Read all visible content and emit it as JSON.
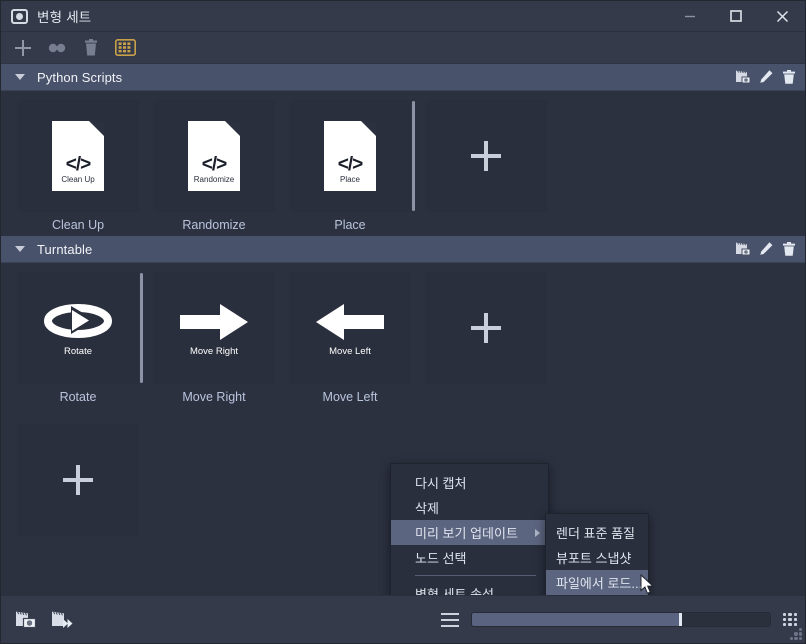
{
  "window": {
    "title": "변형 세트",
    "app_icon": "camera-icon",
    "controls": {
      "minimize": "minimize-icon",
      "maximize": "maximize-icon",
      "close": "close-icon"
    }
  },
  "toolbar": {
    "buttons": [
      {
        "name": "add-button",
        "icon": "plus-icon",
        "active": false
      },
      {
        "name": "duplicate-button",
        "icon": "two-dots-icon",
        "active": false
      },
      {
        "name": "delete-button",
        "icon": "trash-icon",
        "active": false
      },
      {
        "name": "capture-settings-button",
        "icon": "filmstrip-grid-icon",
        "active": true
      }
    ]
  },
  "sections": [
    {
      "title": "Python Scripts",
      "collapsed": false,
      "actions": [
        "recapture-icon",
        "edit-pencil-icon",
        "delete-trash-icon"
      ],
      "tiles": [
        {
          "label": "Clean Up",
          "thumb_type": "script",
          "thumb_text": "Clean Up",
          "selected": false
        },
        {
          "label": "Randomize",
          "thumb_type": "script",
          "thumb_text": "Randomize",
          "selected": false
        },
        {
          "label": "Place",
          "thumb_type": "script",
          "thumb_text": "Place",
          "selected": true
        },
        {
          "label": "",
          "thumb_type": "add",
          "thumb_text": "",
          "selected": false
        }
      ]
    },
    {
      "title": "Turntable",
      "collapsed": false,
      "actions": [
        "recapture-icon",
        "edit-pencil-icon",
        "delete-trash-icon"
      ],
      "tiles": [
        {
          "label": "Rotate",
          "thumb_type": "rotate",
          "thumb_text": "Rotate",
          "selected": true
        },
        {
          "label": "Move Right",
          "thumb_type": "arrow-right",
          "thumb_text": "Move Right",
          "selected": false
        },
        {
          "label": "Move Left",
          "thumb_type": "arrow-left",
          "thumb_text": "Move Left",
          "selected": false
        },
        {
          "label": "",
          "thumb_type": "add",
          "thumb_text": "",
          "selected": false
        }
      ]
    }
  ],
  "add_section": {
    "name": "add-section-tile",
    "icon": "plus-icon"
  },
  "context_menu": {
    "items": [
      {
        "label": "다시 캡처",
        "highlight": false,
        "submenu": false,
        "separator_after": false
      },
      {
        "label": "삭제",
        "highlight": false,
        "submenu": false,
        "separator_after": false
      },
      {
        "label": "미리 보기 업데이트",
        "highlight": true,
        "submenu": true,
        "separator_after": false
      },
      {
        "label": "노드 선택",
        "highlight": false,
        "submenu": false,
        "separator_after": true
      },
      {
        "label": "변형 세트 속성...",
        "highlight": false,
        "submenu": false,
        "separator_after": false
      }
    ]
  },
  "submenu": {
    "items": [
      {
        "label": "렌더 표준 품질",
        "highlight": false
      },
      {
        "label": "뷰포트 스냅샷",
        "highlight": false
      },
      {
        "label": "파일에서 로드...",
        "highlight": true
      }
    ]
  },
  "bottombar": {
    "left_buttons": [
      {
        "name": "capture-thumbnail-button",
        "icon": "clapper-image-icon"
      },
      {
        "name": "capture-animation-button",
        "icon": "clapper-play-icon"
      }
    ],
    "list-view": "list-view-icon",
    "grid-view": "grid-view-icon",
    "zoom_slider": {
      "value": 70,
      "min": 0,
      "max": 100
    }
  },
  "colors": {
    "window_bg": "#343a4a",
    "content_bg": "#2c3140",
    "section_header": "#49526b",
    "tile_bg": "#2a2f3d",
    "menu_bg": "#2a2f3d",
    "menu_highlight": "#5c6580",
    "label_text": "#b9c4dd",
    "accent": "#c8a04a"
  }
}
